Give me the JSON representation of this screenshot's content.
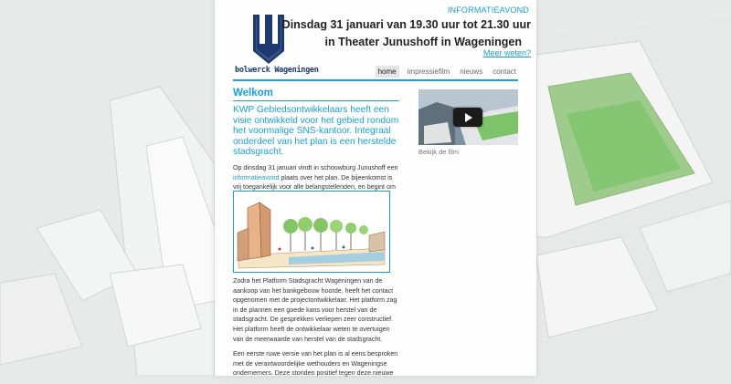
{
  "header": {
    "logo_text": "bolwerck Wageningen",
    "info_label": "INFORMATIEAVOND",
    "event_line1": "Dinsdag 31 januari van 19.30 uur tot 21.30 uur",
    "event_line2": "in Theater Junushoff in Wageningen",
    "more_link": "Meer weten?"
  },
  "nav": {
    "items": [
      "home",
      "impressiefilm",
      "nieuws",
      "contact"
    ],
    "active": "home"
  },
  "main": {
    "title": "Welkom",
    "intro": "KWP Gebiedsontwikkelaars heeft een visie ontwikkeld voor het gebied rondom het voormalige SNS-kantoor. Integraal onderdeel van het plan is een herstelde stadsgracht.",
    "para1_before": "Op dinsdag 31 januari vindt in schouwburg Junushoff een ",
    "para1_link": "informatieavond",
    "para1_after": " plaats over het plan. De bijeenkomst is vrij toegankelijk voor alle belangstellenden, en begint om 19.30u.",
    "para2": "Zodra het Platform Stadsgracht Wageningen van de aankoop van het bankgebouw hoorde, heeft het contact opgenomen met de projectontwikkelaar. Het platform zag in de plannen een goede kans voor herstel van de stadsgracht. De gesprekken verliepen zeer constructief. Het platform heeft de ontwikkelaar weten te overtuigen van de meerwaarde van herstel van de stadsgracht.",
    "para3": "Een eerste ruwe versie van het plan is al eens besproken met de verantwoordelijke wethouders en Wageningse ondernemers. Deze stonden positief tegen deze nieuwe"
  },
  "sidebar": {
    "video_caption": "Bekijk de film"
  },
  "colors": {
    "accent": "#19a0d8",
    "logo_blue": "#1e3a6e",
    "background": "#e7e9e9"
  },
  "icons": {
    "play": "play-icon",
    "logo": "bolwerck-w-logo"
  }
}
